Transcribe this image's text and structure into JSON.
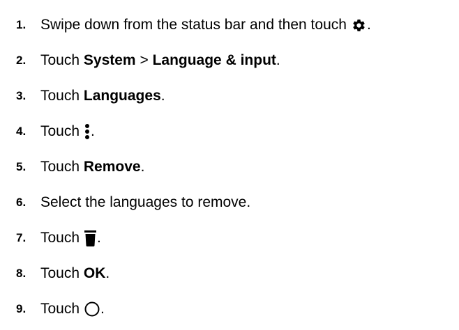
{
  "steps": [
    {
      "number": "1.",
      "pre": "Swipe down from the status bar and then touch",
      "icon": "settings-gear-icon",
      "post": "."
    },
    {
      "number": "2.",
      "pre": "Touch",
      "bold1": "System",
      "mid": ">",
      "bold2": "Language & input",
      "post": "."
    },
    {
      "number": "3.",
      "pre": "Touch",
      "bold": "Languages",
      "post": "."
    },
    {
      "number": "4.",
      "pre": "Touch",
      "icon": "more-options-vertical-dots-icon",
      "post": "."
    },
    {
      "number": "5.",
      "pre": "Touch",
      "bold": "Remove",
      "post": "."
    },
    {
      "number": "6.",
      "text": "Select the languages to remove."
    },
    {
      "number": "7.",
      "pre": "Touch",
      "icon": "trash-icon",
      "post": "."
    },
    {
      "number": "8.",
      "pre": "Touch",
      "bold": "OK",
      "post": "."
    },
    {
      "number": "9.",
      "pre": "Touch",
      "icon": "home-circle-icon",
      "post": "."
    }
  ]
}
